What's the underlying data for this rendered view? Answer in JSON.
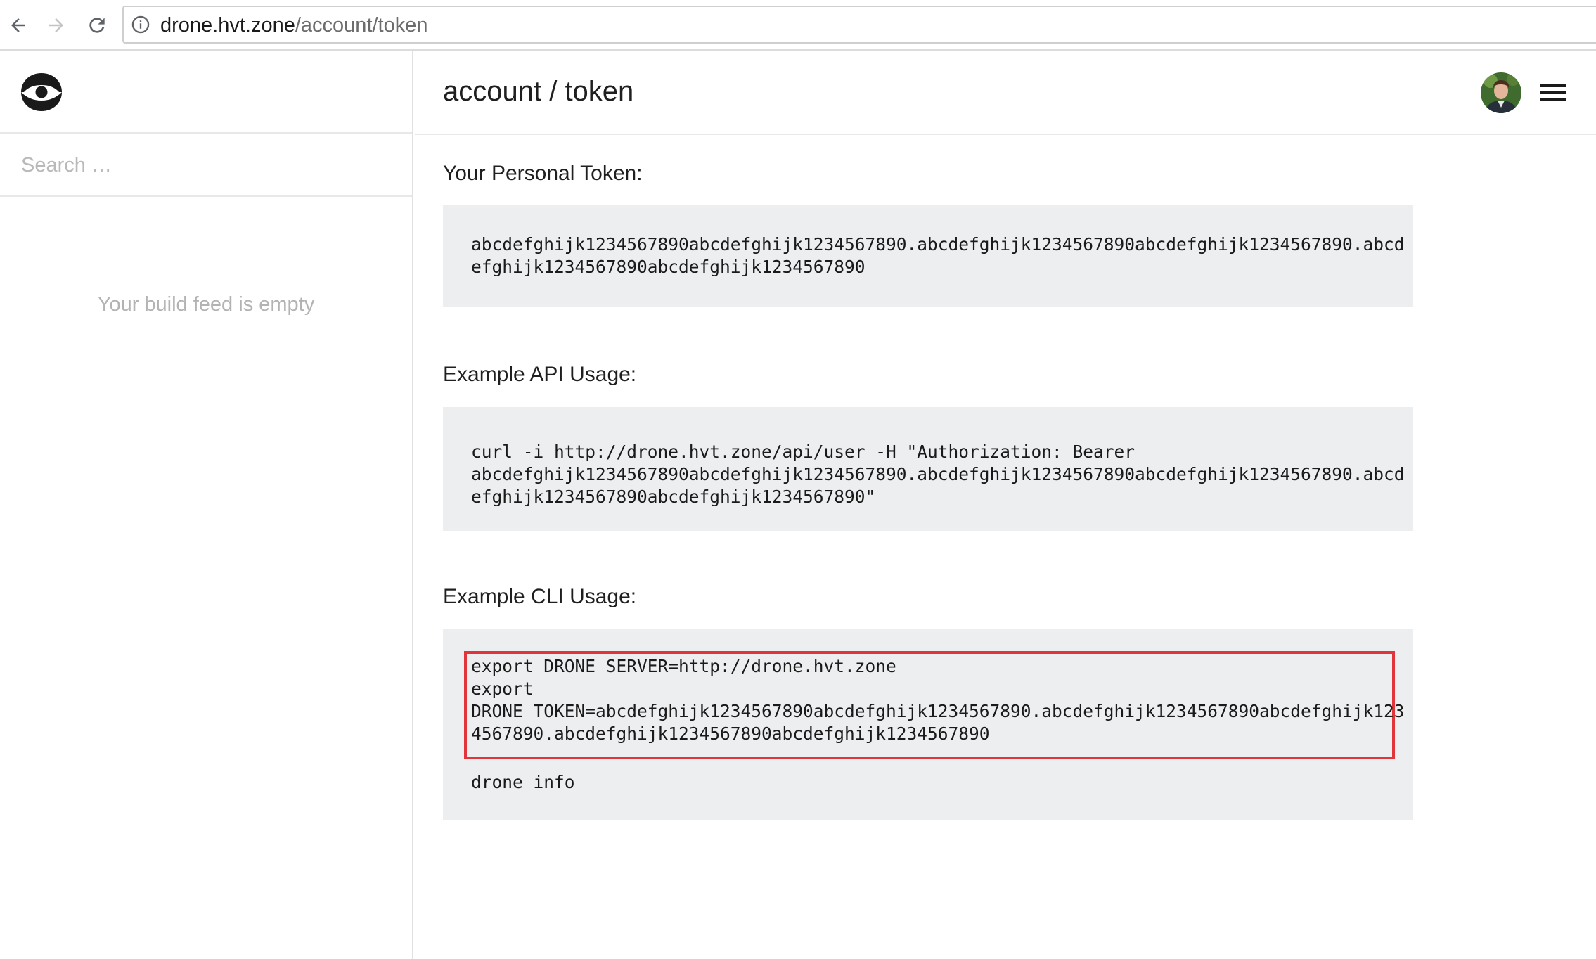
{
  "browser": {
    "url_host": "drone.hvt.zone",
    "url_path": "/account/token",
    "icons": [
      "back-arrow-icon",
      "forward-arrow-icon",
      "reload-icon",
      "info-icon"
    ]
  },
  "sidebar": {
    "search_placeholder": "Search …",
    "empty_feed": "Your build feed is empty"
  },
  "header": {
    "title": "account / token"
  },
  "sections": {
    "token_label": "Your Personal Token:",
    "token_lines": [
      "abcdefghijk1234567890abcdefghijk1234567890.abcdefghijk1234567890abcdefghijk1234567890.abcd",
      "efghijk1234567890abcdefghijk1234567890"
    ],
    "api_label": "Example API Usage:",
    "api_lines": [
      "curl -i http://drone.hvt.zone/api/user -H \"Authorization: Bearer",
      "abcdefghijk1234567890abcdefghijk1234567890.abcdefghijk1234567890abcdefghijk1234567890.abcd",
      "efghijk1234567890abcdefghijk1234567890\""
    ],
    "cli_label": "Example CLI Usage:",
    "cli_lines": [
      "export DRONE_SERVER=http://drone.hvt.zone",
      "export",
      "DRONE_TOKEN=abcdefghijk1234567890abcdefghijk1234567890.abcdefghijk1234567890abcdefghijk123",
      "4567890.abcdefghijk1234567890abcdefghijk1234567890"
    ],
    "cli_tail": "drone info"
  },
  "colors": {
    "code_background": "#eceef0",
    "highlight_border": "#e0363b",
    "muted_text": "#b3b3b3"
  }
}
